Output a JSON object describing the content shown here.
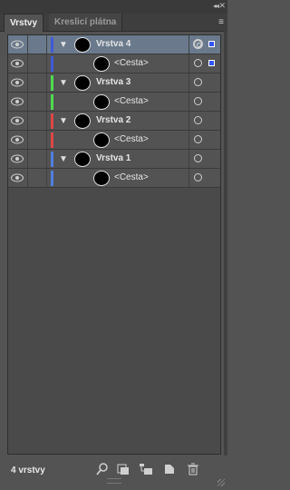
{
  "window": {
    "collapse_glyph": "◂◂",
    "close_glyph": "✕"
  },
  "tabs": [
    {
      "label": "Vrstvy",
      "active": true
    },
    {
      "label": "Kreslicí plátna",
      "active": false
    }
  ],
  "panel_menu_glyph": "≡",
  "layers": [
    {
      "name": "Vrstva 4",
      "type": "layer",
      "color": "#3f5bd6",
      "selected": true,
      "expanded": true
    },
    {
      "name": "<Cesta>",
      "type": "path",
      "color": "#3f5bd6",
      "selected": false
    },
    {
      "name": "Vrstva 3",
      "type": "layer",
      "color": "#4fd94f",
      "selected": false,
      "expanded": true
    },
    {
      "name": "<Cesta>",
      "type": "path",
      "color": "#4fd94f",
      "selected": false
    },
    {
      "name": "Vrstva 2",
      "type": "layer",
      "color": "#e04646",
      "selected": false,
      "expanded": true
    },
    {
      "name": "<Cesta>",
      "type": "path",
      "color": "#e04646",
      "selected": false
    },
    {
      "name": "Vrstva 1",
      "type": "layer",
      "color": "#4f7fe0",
      "selected": false,
      "expanded": true
    },
    {
      "name": "<Cesta>",
      "type": "path",
      "color": "#4f7fe0",
      "selected": false
    }
  ],
  "footer": {
    "count_label": "4 vrstvy",
    "icons": [
      "locate-object-icon",
      "make-clipping-mask-icon",
      "create-sublayer-icon",
      "create-new-layer-icon",
      "delete-layer-icon"
    ]
  }
}
